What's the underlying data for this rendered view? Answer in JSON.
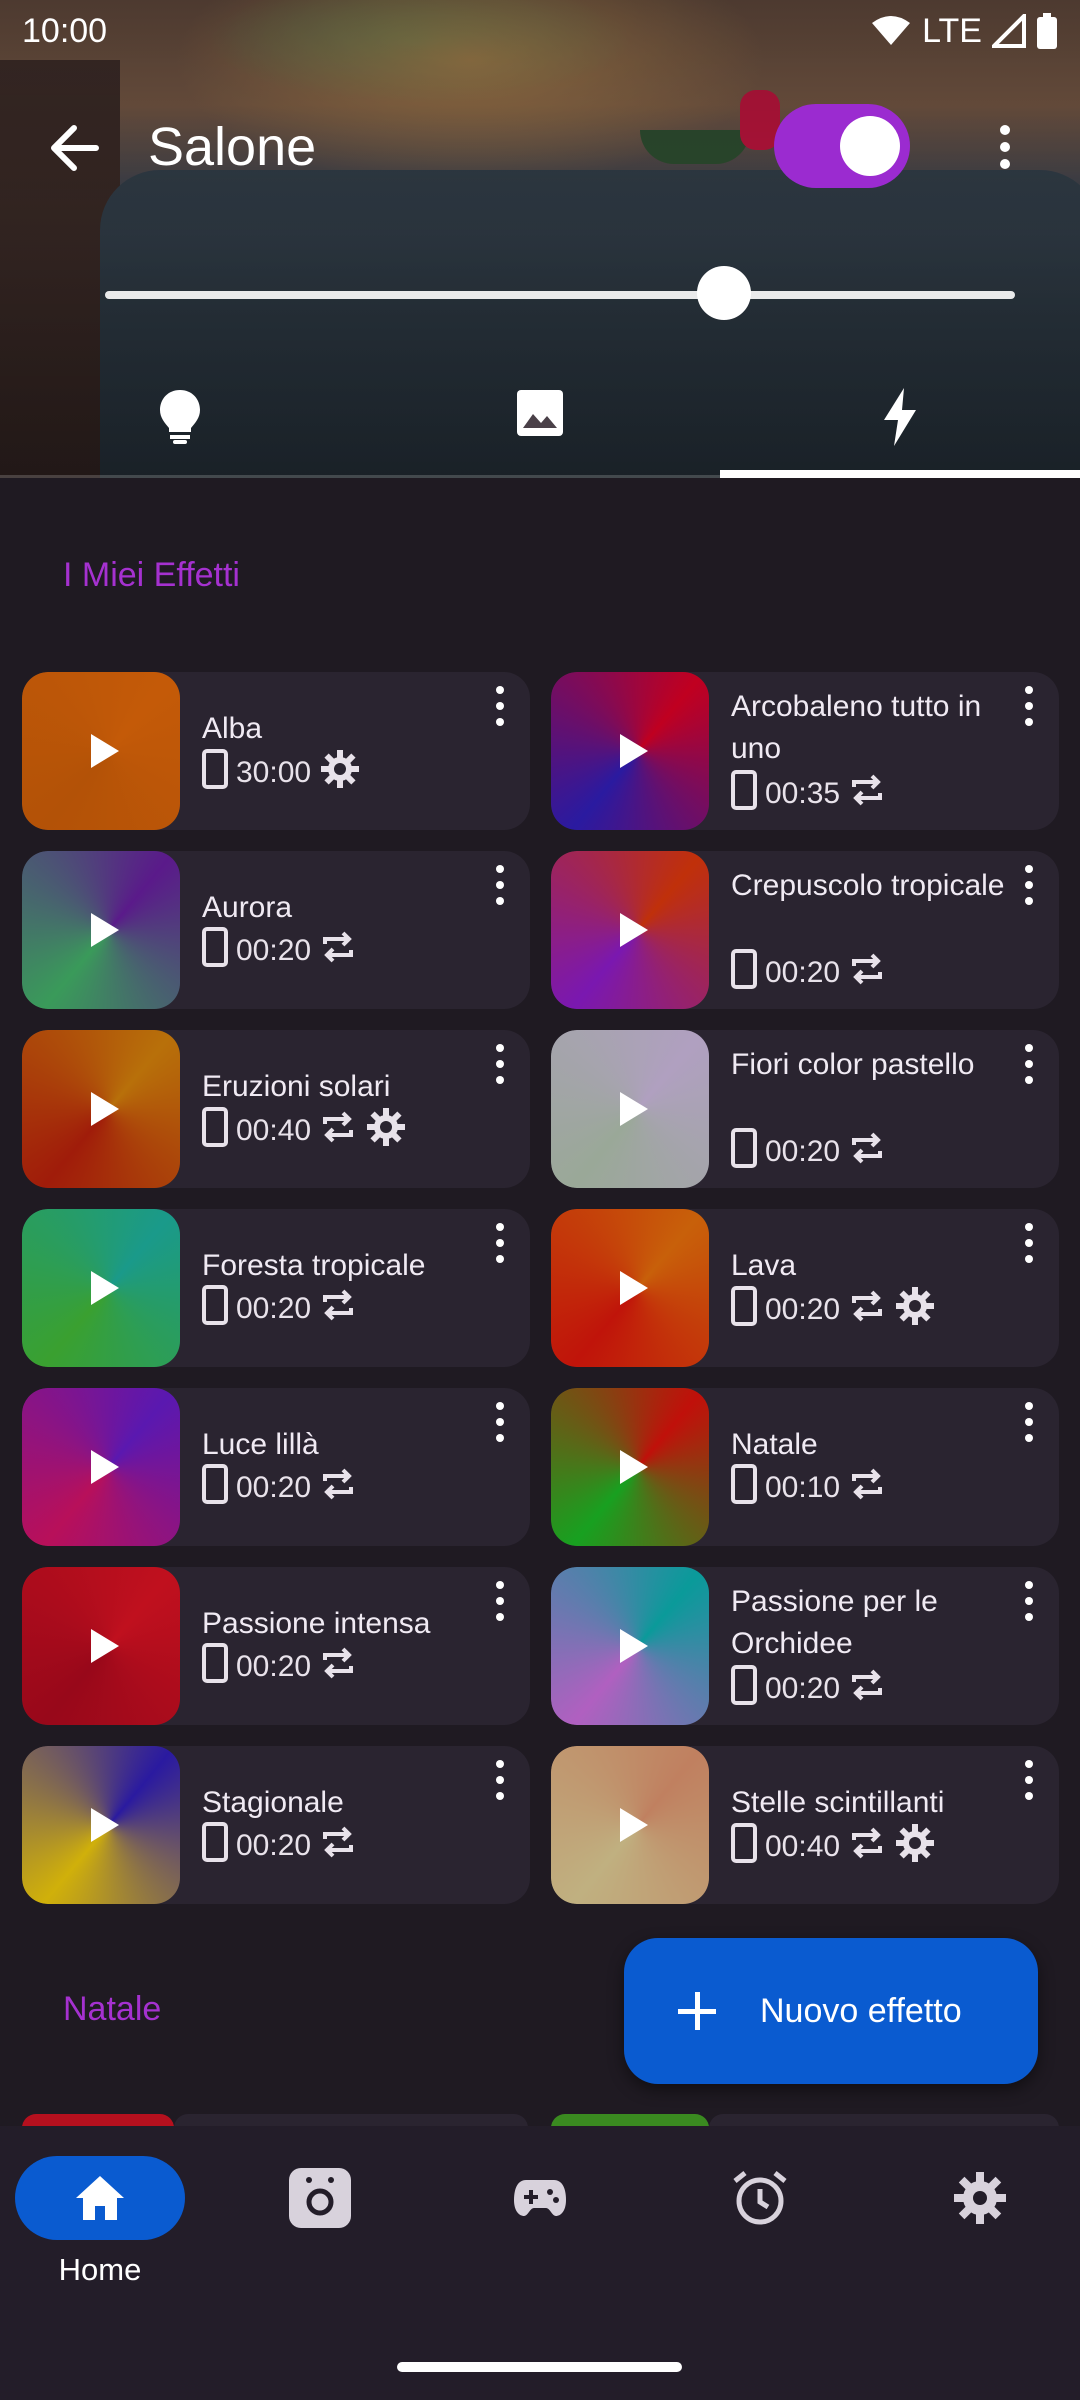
{
  "status": {
    "time": "10:00",
    "network": "LTE"
  },
  "header": {
    "title": "Salone",
    "power_on": true,
    "brightness": 0.68
  },
  "tabs": [
    {
      "icon": "lightbulb-icon",
      "active": false
    },
    {
      "icon": "image-icon",
      "active": false
    },
    {
      "icon": "lightning-icon",
      "active": true
    }
  ],
  "sections": {
    "my_effects": "I Miei Effetti",
    "natale": "Natale"
  },
  "effects": [
    {
      "name": "Alba",
      "time": "30:00",
      "loop": false,
      "settings": true,
      "colors": [
        "#c45a08",
        "#b35207"
      ]
    },
    {
      "name": "Arcobaleno tutto in uno",
      "time": "00:35",
      "loop": true,
      "settings": false,
      "colors": [
        "#c00020",
        "#2a1aa0"
      ]
    },
    {
      "name": "Aurora",
      "time": "00:20",
      "loop": true,
      "settings": false,
      "colors": [
        "#5a1a8a",
        "#3a9a5a"
      ]
    },
    {
      "name": "Crepuscolo tropicale",
      "time": "00:20",
      "loop": true,
      "settings": false,
      "colors": [
        "#c0300a",
        "#7a18b0"
      ]
    },
    {
      "name": "Eruzioni solari",
      "time": "00:40",
      "loop": true,
      "settings": true,
      "colors": [
        "#b8700a",
        "#a01c0a"
      ]
    },
    {
      "name": "Fiori color pastello",
      "time": "00:20",
      "loop": true,
      "settings": false,
      "colors": [
        "#b0a0c0",
        "#9aa898"
      ]
    },
    {
      "name": "Foresta tropicale",
      "time": "00:20",
      "loop": true,
      "settings": false,
      "colors": [
        "#1a9a8a",
        "#3aa030"
      ]
    },
    {
      "name": "Lava",
      "time": "00:20",
      "loop": true,
      "settings": true,
      "colors": [
        "#c8600a",
        "#c0140a"
      ]
    },
    {
      "name": "Luce lillà",
      "time": "00:20",
      "loop": true,
      "settings": false,
      "colors": [
        "#5a18b0",
        "#b8105a"
      ]
    },
    {
      "name": "Natale",
      "time": "00:10",
      "loop": true,
      "settings": false,
      "colors": [
        "#c0100a",
        "#18a020"
      ]
    },
    {
      "name": "Passione intensa",
      "time": "00:20",
      "loop": true,
      "settings": false,
      "colors": [
        "#c0101e",
        "#98081a"
      ]
    },
    {
      "name": "Passione per le Orchidee",
      "time": "00:20",
      "loop": true,
      "settings": false,
      "colors": [
        "#0a9a9a",
        "#b060c0"
      ]
    },
    {
      "name": "Stagionale",
      "time": "00:20",
      "loop": true,
      "settings": false,
      "colors": [
        "#2a1aa0",
        "#d0b00a"
      ]
    },
    {
      "name": "Stelle scintillanti",
      "time": "00:40",
      "loop": true,
      "settings": true,
      "colors": [
        "#c08060",
        "#c0b080"
      ]
    }
  ],
  "fab": {
    "label": "Nuovo effetto"
  },
  "nav": [
    {
      "icon": "home-icon",
      "label": "Home",
      "active": true
    },
    {
      "icon": "camera-icon",
      "label": "",
      "active": false
    },
    {
      "icon": "gamepad-icon",
      "label": "",
      "active": false
    },
    {
      "icon": "alarm-icon",
      "label": "",
      "active": false
    },
    {
      "icon": "gear-icon",
      "label": "",
      "active": false
    }
  ],
  "colors": {
    "accent": "#a531d0",
    "primary": "#0a5bd0",
    "toggle": "#9b2bd0",
    "background": "#1f1a22",
    "card": "#2a2430"
  }
}
